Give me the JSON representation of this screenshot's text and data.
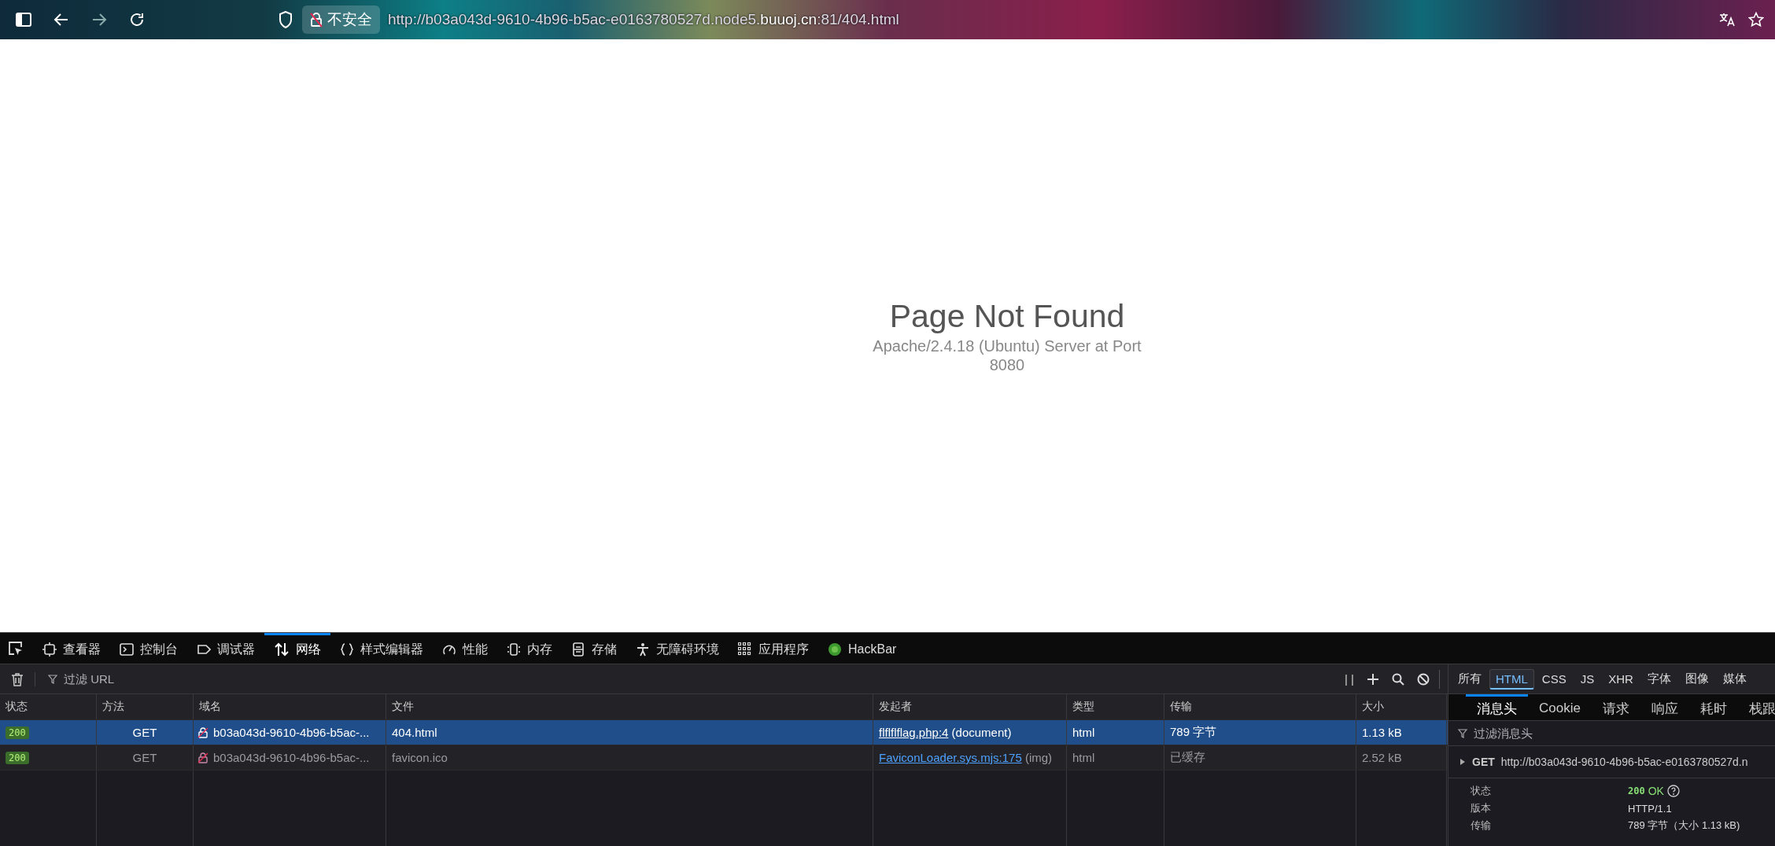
{
  "browser": {
    "security_label": "不安全",
    "url": {
      "prefix": "http://b03a043d-9610-4b96-b5ac-e0163780527d.node5.",
      "domain": "buuoj.cn",
      "suffix": ":81/404.html"
    }
  },
  "page": {
    "title": "Page Not Found",
    "subtitle": "Apache/2.4.18 (Ubuntu) Server at Port 8080"
  },
  "devtools": {
    "tabs": [
      {
        "kind": "inspector",
        "label": "查看器",
        "selected": false
      },
      {
        "kind": "console",
        "label": "控制台",
        "selected": false
      },
      {
        "kind": "debugger",
        "label": "调试器",
        "selected": false
      },
      {
        "kind": "network",
        "label": "网络",
        "selected": true
      },
      {
        "kind": "style",
        "label": "样式编辑器",
        "selected": false
      },
      {
        "kind": "performance",
        "label": "性能",
        "selected": false
      },
      {
        "kind": "memory",
        "label": "内存",
        "selected": false
      },
      {
        "kind": "storage",
        "label": "存储",
        "selected": false
      },
      {
        "kind": "accessibility",
        "label": "无障碍环境",
        "selected": false
      },
      {
        "kind": "application",
        "label": "应用程序",
        "selected": false
      },
      {
        "kind": "hackbar",
        "label": "HackBar",
        "selected": false
      }
    ],
    "filter": {
      "placeholder": "过滤 URL"
    },
    "pause_label": "| |",
    "type_filters": [
      {
        "label": "所有",
        "selected": false
      },
      {
        "label": "HTML",
        "selected": true
      },
      {
        "label": "CSS",
        "selected": false
      },
      {
        "label": "JS",
        "selected": false
      },
      {
        "label": "XHR",
        "selected": false
      },
      {
        "label": "字体",
        "selected": false
      },
      {
        "label": "图像",
        "selected": false
      },
      {
        "label": "媒体",
        "selected": false
      }
    ],
    "columns": [
      "状态",
      "方法",
      "域名",
      "文件",
      "发起者",
      "类型",
      "传输",
      "大小"
    ],
    "rows": [
      {
        "status": "200",
        "method": "GET",
        "domain": "b03a043d-9610-4b96-b5ac-...",
        "file": "404.html",
        "initiator": "flflflflag.php:4",
        "initiator_type": "(document)",
        "type": "html",
        "transfer": "789 字节",
        "size": "1.13 kB",
        "selected": true,
        "cached": false
      },
      {
        "status": "200",
        "method": "GET",
        "domain": "b03a043d-9610-4b96-b5ac-...",
        "file": "favicon.ico",
        "initiator": "FaviconLoader.sys.mjs:175",
        "initiator_type": "(img)",
        "type": "html",
        "transfer": "已缓存",
        "size": "2.52 kB",
        "selected": false,
        "cached": true
      }
    ],
    "details": {
      "tabs": [
        {
          "label": "消息头",
          "selected": true
        },
        {
          "label": "Cookie",
          "selected": false
        },
        {
          "label": "请求",
          "selected": false
        },
        {
          "label": "响应",
          "selected": false
        },
        {
          "label": "耗时",
          "selected": false
        },
        {
          "label": "栈跟",
          "selected": false
        }
      ],
      "filter_placeholder": "过滤消息头",
      "method": "GET",
      "url": "http://b03a043d-9610-4b96-b5ac-e0163780527d.n",
      "fields": [
        {
          "kind": "status",
          "label": "状态",
          "code": "200",
          "text": "OK"
        },
        {
          "kind": "text",
          "label": "版本",
          "value": "HTTP/1.1"
        },
        {
          "kind": "text",
          "label": "传输",
          "value": "789 字节（大小 1.13 kB)"
        }
      ]
    }
  }
}
